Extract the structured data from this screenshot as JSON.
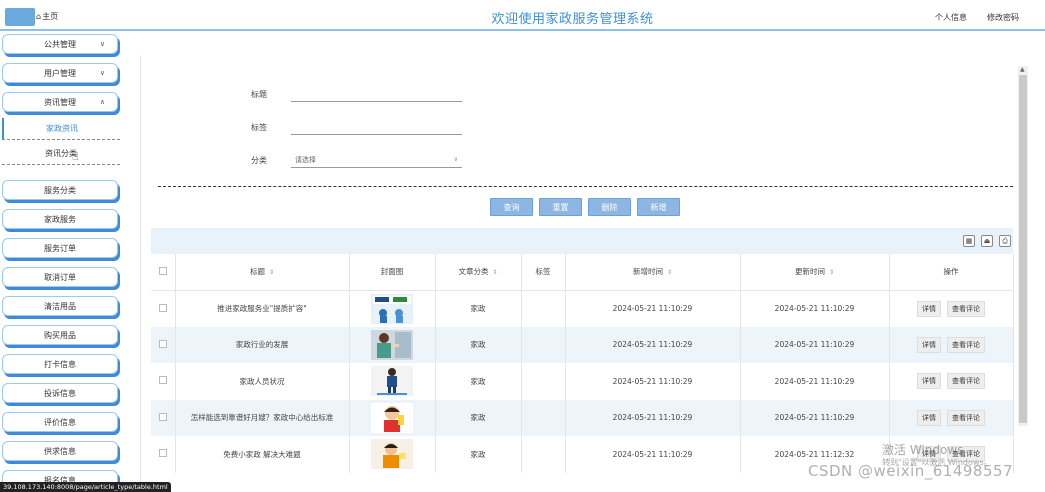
{
  "header": {
    "home": "主页",
    "title": "欢迎使用家政服务管理系统",
    "links": [
      "个人信息",
      "修改密码"
    ]
  },
  "sidebar": {
    "top_items": [
      {
        "label": "公共管理",
        "chevron": "∨"
      },
      {
        "label": "用户管理",
        "chevron": "∨"
      },
      {
        "label": "资讯管理",
        "chevron": "∧"
      }
    ],
    "sub_items": [
      {
        "label": "家政资讯",
        "active": true
      },
      {
        "label": "资讯分类",
        "active": false
      }
    ],
    "items": [
      "服务分类",
      "家政服务",
      "服务订单",
      "取消订单",
      "清洁用品",
      "购买用品",
      "打卡信息",
      "投诉信息",
      "评价信息",
      "供求信息",
      "报名信息"
    ]
  },
  "search": {
    "title_label": "标题",
    "tag_label": "标签",
    "category_label": "分类",
    "category_placeholder": "请选择"
  },
  "actions": [
    "查询",
    "重置",
    "删除",
    "新增"
  ],
  "table": {
    "columns": [
      "标题",
      "封面图",
      "文章分类",
      "标签",
      "新增时间",
      "更新时间",
      "操作"
    ],
    "rows": [
      {
        "title": "推进家政服务业\"提质扩容\"",
        "category": "家政",
        "tag": "",
        "created": "2024-05-21 11:10:29",
        "updated": "2024-05-21 11:10:29"
      },
      {
        "title": "家政行业的发展",
        "category": "家政",
        "tag": "",
        "created": "2024-05-21 11:10:29",
        "updated": "2024-05-21 11:10:29"
      },
      {
        "title": "家政人员状况",
        "category": "家政",
        "tag": "",
        "created": "2024-05-21 11:10:29",
        "updated": "2024-05-21 11:10:29"
      },
      {
        "title": "怎样能选到靠谱好月嫂？家政中心给出标准",
        "category": "家政",
        "tag": "",
        "created": "2024-05-21 11:10:29",
        "updated": "2024-05-21 11:10:29"
      },
      {
        "title": "免费小家政 解决大难题",
        "category": "家政",
        "tag": "",
        "created": "2024-05-21 11:10:29",
        "updated": "2024-05-21 11:12:32"
      }
    ],
    "op_detail": "详情",
    "op_comments": "查看评论"
  },
  "status_url": "39.108.173.140:8008/page/article_type/table.html",
  "watermark": {
    "line1": "激活 Windows",
    "line2": "转到\"设置\"以激活 Windows。",
    "csdn": "CSDN @weixin_61498557"
  },
  "colors": {
    "accent": "#3e8fd6",
    "button": "#8eb6e3",
    "stripe": "#edf5fa"
  }
}
